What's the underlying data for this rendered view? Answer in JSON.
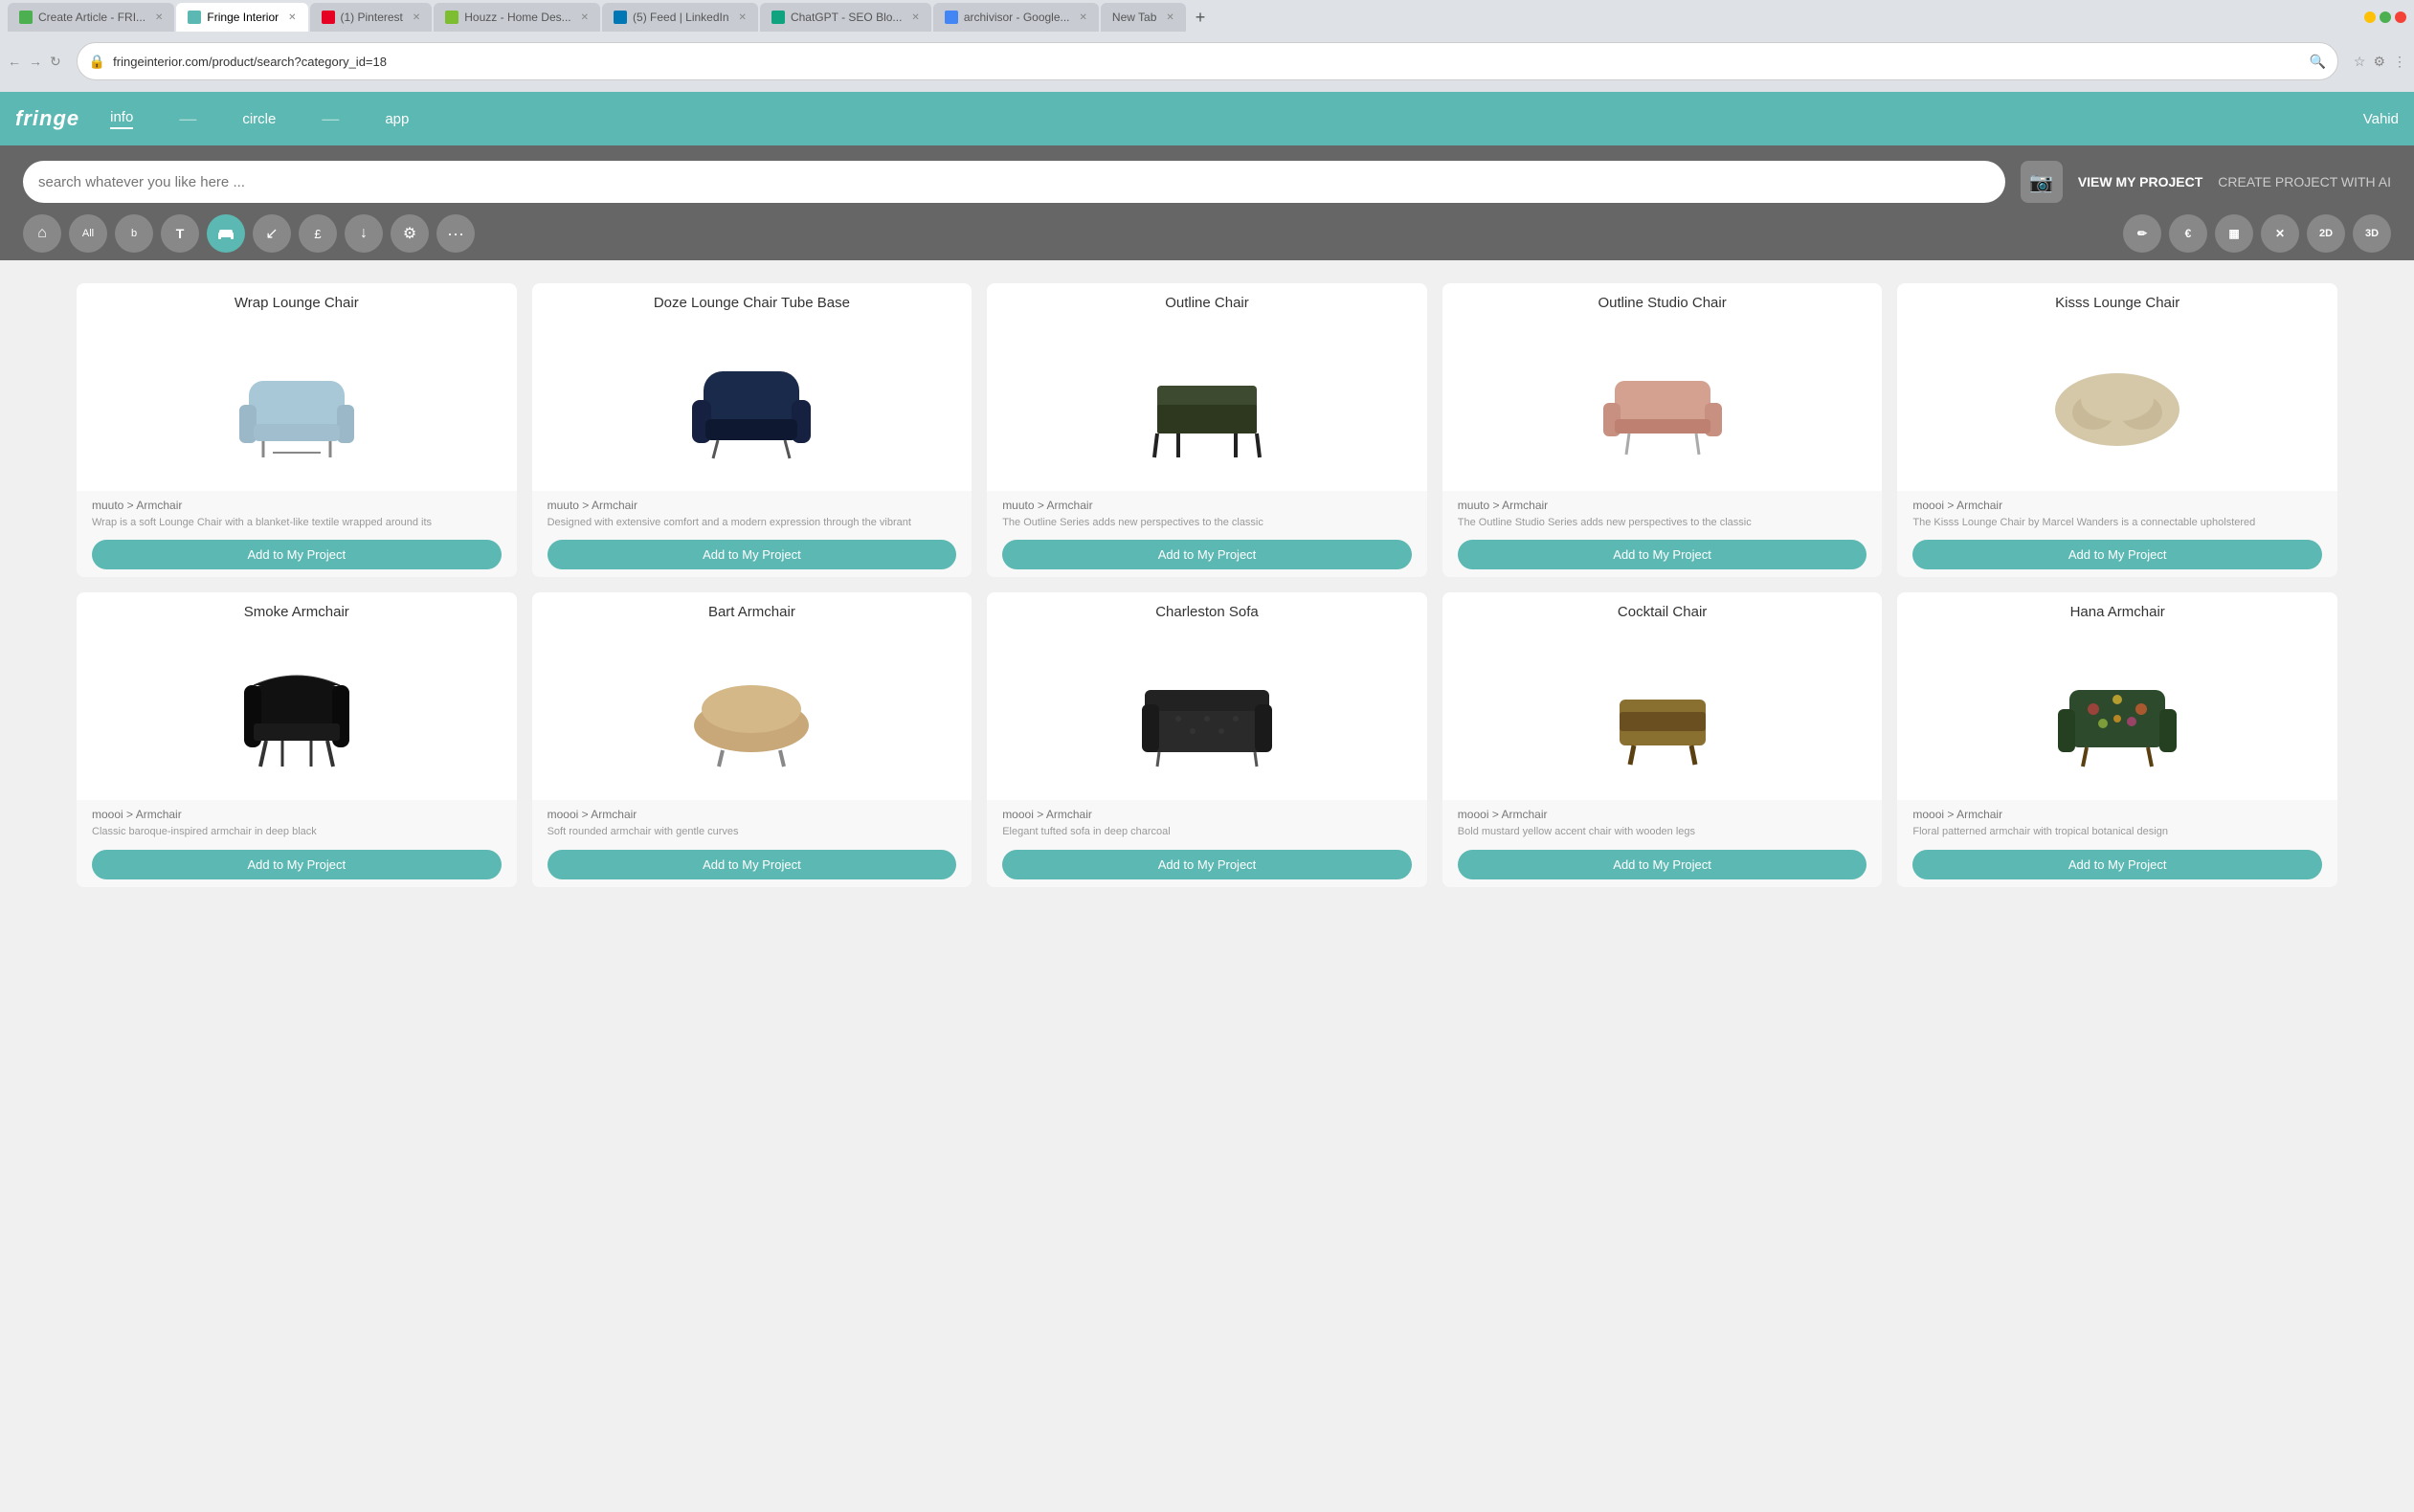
{
  "browser": {
    "tabs": [
      {
        "id": "tab-1",
        "label": "Create Article - FRI...",
        "active": false,
        "color": "#4CAF50"
      },
      {
        "id": "tab-2",
        "label": "Fringe Interior",
        "active": true,
        "color": "#5cb8b2"
      },
      {
        "id": "tab-3",
        "label": "(1) Pinterest",
        "active": false,
        "color": "#E60023"
      },
      {
        "id": "tab-4",
        "label": "Houzz - Home Des...",
        "active": false,
        "color": "#7DBE31"
      },
      {
        "id": "tab-5",
        "label": "(5) Feed | LinkedIn",
        "active": false,
        "color": "#0077B5"
      },
      {
        "id": "tab-6",
        "label": "ChatGPT - SEO Blo...",
        "active": false,
        "color": "#10A37F"
      },
      {
        "id": "tab-7",
        "label": "archivisor - Google...",
        "active": false,
        "color": "#4285F4"
      },
      {
        "id": "tab-8",
        "label": "New Tab",
        "active": false,
        "color": "#888"
      }
    ],
    "url": "fringeinterior.com/product/search?category_id=18"
  },
  "header": {
    "logo": "fringe",
    "nav": [
      {
        "id": "info",
        "label": "info",
        "active": true
      },
      {
        "id": "circle",
        "label": "circle",
        "active": false
      },
      {
        "id": "app",
        "label": "app",
        "active": false
      }
    ],
    "user": "Vahid"
  },
  "toolbar": {
    "search_placeholder": "search whatever you like here ...",
    "view_my_project": "VIEW MY PROJECT",
    "create_project": "CREATE PROJECT WITH AI",
    "filters": [
      {
        "id": "home",
        "icon": "⌂",
        "active": false
      },
      {
        "id": "all",
        "label": "All",
        "active": false
      },
      {
        "id": "b",
        "label": "b",
        "active": false
      },
      {
        "id": "text",
        "icon": "T",
        "active": false
      },
      {
        "id": "chair",
        "icon": "⊡",
        "active": true
      },
      {
        "id": "arrow",
        "icon": "↙",
        "active": false
      },
      {
        "id": "money",
        "icon": "£",
        "active": false
      },
      {
        "id": "download",
        "icon": "↓",
        "active": false
      },
      {
        "id": "settings",
        "icon": "⚙",
        "active": false
      },
      {
        "id": "more",
        "icon": "···",
        "active": false
      }
    ],
    "view_options": [
      {
        "id": "pencil",
        "icon": "✏",
        "label": "pencil"
      },
      {
        "id": "euro",
        "icon": "€",
        "label": "euro"
      },
      {
        "id": "bar",
        "icon": "▦",
        "label": "bar"
      },
      {
        "id": "x",
        "icon": "✕",
        "label": "x"
      },
      {
        "id": "2d",
        "label": "2D"
      },
      {
        "id": "3d",
        "label": "3D"
      }
    ]
  },
  "products": [
    {
      "id": "wrap-lounge",
      "title": "Wrap Lounge Chair",
      "brand": "muuto > Armchair",
      "description": "Wrap is a soft Lounge Chair with a blanket-like textile wrapped around its",
      "add_label": "Add to My Project",
      "color": "#a8c8d8",
      "shape": "armchair-light"
    },
    {
      "id": "doze-lounge",
      "title": "Doze Lounge Chair Tube Base",
      "brand": "muuto > Armchair",
      "description": "Designed with extensive comfort and a modern expression through the vibrant",
      "add_label": "Add to My Project",
      "color": "#1a2a4a",
      "shape": "armchair-dark"
    },
    {
      "id": "outline-chair",
      "title": "Outline Chair",
      "brand": "muuto > Armchair",
      "description": "The Outline Series adds new perspectives to the classic",
      "add_label": "Add to My Project",
      "color": "#3d4a30",
      "shape": "armchair-olive"
    },
    {
      "id": "outline-studio",
      "title": "Outline Studio Chair",
      "brand": "muuto > Armchair",
      "description": "The Outline Studio Series adds new perspectives to the classic",
      "add_label": "Add to My Project",
      "color": "#d4a090",
      "shape": "armchair-pink"
    },
    {
      "id": "kisss-lounge",
      "title": "Kisss Lounge Chair",
      "brand": "moooi > Armchair",
      "description": "The Kisss Lounge Chair by Marcel Wanders is a connectable upholstered",
      "add_label": "Add to My Project",
      "color": "#d4c8a8",
      "shape": "kisss"
    },
    {
      "id": "smoke-armchair",
      "title": "Smoke Armchair",
      "brand": "moooi > Armchair",
      "description": "Classic baroque-inspired armchair in deep black",
      "add_label": "Add to My Project",
      "color": "#111",
      "shape": "baroque"
    },
    {
      "id": "bart-armchair",
      "title": "Bart Armchair",
      "brand": "moooi > Armchair",
      "description": "Soft rounded armchair with gentle curves",
      "add_label": "Add to My Project",
      "color": "#c8a878",
      "shape": "rounded"
    },
    {
      "id": "charleston-sofa",
      "title": "Charleston Sofa",
      "brand": "moooi > Armchair",
      "description": "Elegant tufted sofa in deep charcoal",
      "add_label": "Add to My Project",
      "color": "#2a2a2a",
      "shape": "sofa"
    },
    {
      "id": "cocktail-chair",
      "title": "Cocktail Chair",
      "brand": "moooi > Armchair",
      "description": "Bold mustard yellow accent chair with wooden legs",
      "add_label": "Add to My Project",
      "color": "#8a7030",
      "shape": "cocktail"
    },
    {
      "id": "hana-armchair",
      "title": "Hana Armchair",
      "brand": "moooi > Armchair",
      "description": "Floral patterned armchair with tropical botanical design",
      "add_label": "Add to My Project",
      "color": "#2d4a2d",
      "shape": "floral"
    }
  ]
}
